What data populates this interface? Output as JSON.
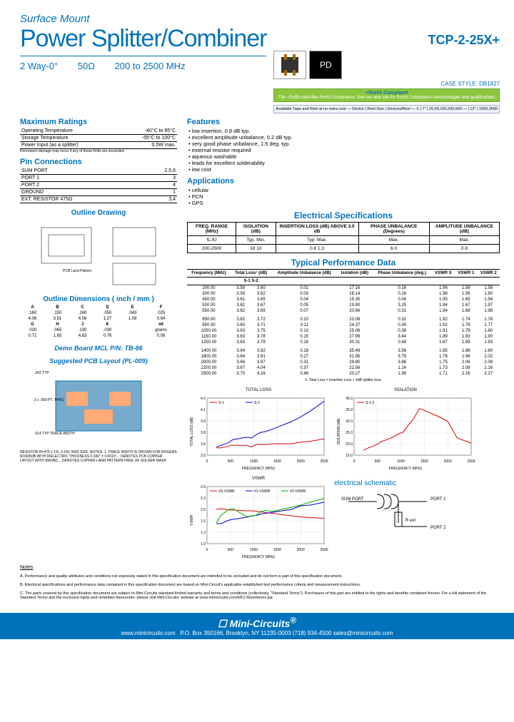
{
  "header": {
    "pretitle": "Surface Mount",
    "title": "Power Splitter/Combiner",
    "partno": "TCP-2-25X+",
    "subline": {
      "ways": "2 Way-0°",
      "impedance": "50Ω",
      "freq": "200 to 2500 MHz"
    },
    "case_style": "CASE STYLE: DB1827",
    "rohs_title": "+RoHS Compliant",
    "rohs_text": "The +Suffix identifies RoHS Compliance. See our web site for RoHS Compliance methodologies and qualifications"
  },
  "max_ratings": {
    "title": "Maximum Ratings",
    "rows": [
      [
        "Operating Temperature",
        "-40°C to 85°C"
      ],
      [
        "Storage Temperature",
        "-55°C to 100°C"
      ],
      [
        "Power Input (as a splitter)",
        "0.5W max."
      ]
    ],
    "note": "Permanent damage may occur if any of these limits are exceeded."
  },
  "pins": {
    "title": "Pin Connections",
    "rows": [
      [
        "SUM PORT",
        "2,5,6"
      ],
      [
        "PORT 1",
        "3"
      ],
      [
        "PORT 2",
        "4"
      ],
      [
        "GROUND",
        "1"
      ],
      [
        "EXT. RESISTOR 475Ω",
        "3,4"
      ]
    ]
  },
  "features": {
    "title": "Features",
    "items": [
      "low insertion, 0.8 dB typ.",
      "excellent amplitude unbalance, 0.2 dB typ.",
      "very good phase unbalance, 1.5 deg. typ.",
      "external resistor required",
      "aqueous washable",
      "leads for excellent solderability",
      "low cost"
    ]
  },
  "applications": {
    "title": "Applications",
    "items": [
      "cellular",
      "PCN",
      "GPS"
    ]
  },
  "espec": {
    "title": "Electrical Specifications",
    "headers": [
      "FREQ. RANGE (MHz)",
      "ISOLATION (dB)",
      "INSERTION LOSS (dB) ABOVE 3.0 dB",
      "PHASE UNBALANCE (Degrees)",
      "AMPLITUDE UNBALANCE (dB)"
    ],
    "sub": [
      "fL-fU",
      "Typ.  Min.",
      "Typ.  Max.",
      "Max.",
      "Max."
    ],
    "row": [
      "200-2500",
      "18   10",
      "0.8   1.3",
      "6.0",
      "0.8"
    ]
  },
  "perf": {
    "title": "Typical Performance Data",
    "headers": [
      "Frequency (MHz)",
      "Total Loss¹ (dB)",
      "Amplitude Unbalance (dB)",
      "Isolation (dB)",
      "Phase Unbalance (deg.)",
      "VSWR S",
      "VSWR 1",
      "VSWR 2"
    ],
    "sub": [
      "",
      "S-1   S-2",
      "",
      "",
      "",
      "",
      "",
      ""
    ],
    "rows": [
      [
        "200.00",
        "3.59",
        "3.60",
        "0.01",
        "17.16",
        "0.16",
        "1.96",
        "1.56",
        "1.58"
      ],
      [
        "300.00",
        "3.59",
        "3.62",
        "0.03",
        "18.14",
        "0.16",
        "1.98",
        "1.56",
        "1.80"
      ],
      [
        "450.00",
        "3.61",
        "3.65",
        "0.04",
        "19.35",
        "0.04",
        "1.95",
        "1.65",
        "1.94"
      ],
      [
        "500.00",
        "3.62",
        "3.67",
        "0.05",
        "19.80",
        "3.25",
        "1.94",
        "1.67",
        "1.97"
      ],
      [
        "550.00",
        "3.62",
        "3.69",
        "0.07",
        "20.66",
        "0.31",
        "1.94",
        "1.68",
        "1.98"
      ],
      [
        "850.00",
        "3.62",
        "3.72",
        "0.10",
        "23.08",
        "0.32",
        "1.92",
        "1.74",
        "1.76"
      ],
      [
        "950.00",
        "3.60",
        "3.71",
        "0.11",
        "24.37",
        "0.35",
        "1.92",
        "1.78",
        "1.77"
      ],
      [
        "1050.00",
        "3.63",
        "3.75",
        "0.13",
        "25.06",
        "0.38",
        "1.91",
        "1.79",
        "1.80"
      ],
      [
        "1150.00",
        "3.63",
        "3.78",
        "0.15",
        "27.99",
        "3.44",
        "1.89",
        "1.83",
        "1.90"
      ],
      [
        "1250.00",
        "3.63",
        "3.79",
        "0.16",
        "30.31",
        "0.48",
        "1.87",
        "1.85",
        "1.93"
      ],
      [
        "1400.00",
        "3.64",
        "3.82",
        "0.18",
        "35.48",
        "3.56",
        "1.85",
        "1.88",
        "1.90"
      ],
      [
        "1800.00",
        "3.64",
        "3.91",
        "0.27",
        "31.95",
        "3.79",
        "1.78",
        "1.96",
        "2.02"
      ],
      [
        "2000.00",
        "3.66",
        "3.97",
        "0.31",
        "29.80",
        "3.86",
        "1.75",
        "2.06",
        "2.08"
      ],
      [
        "2200.00",
        "3.67",
        "4.04",
        "0.37",
        "22.56",
        "1.14",
        "1.73",
        "2.08",
        "2.16"
      ],
      [
        "2500.00",
        "3.70",
        "4.16",
        "0.46",
        "20.27",
        "1.38",
        "1.71",
        "2.16",
        "2.27"
      ]
    ],
    "footnote": "1. Total Loss = Insertion Loss + 3dB splitter loss."
  },
  "chart_data": [
    {
      "type": "line",
      "title": "TOTAL LOSS",
      "xlabel": "FREQUENCY (MHz)",
      "ylabel": "TOTAL LOSS (dB)",
      "xlim": [
        0,
        2500
      ],
      "ylim": [
        3.5,
        4.2
      ],
      "x": [
        200,
        300,
        450,
        500,
        550,
        850,
        950,
        1050,
        1150,
        1250,
        1400,
        1800,
        2000,
        2200,
        2500
      ],
      "series": [
        {
          "name": "S-1",
          "color": "#d00",
          "values": [
            3.59,
            3.59,
            3.61,
            3.62,
            3.62,
            3.62,
            3.6,
            3.63,
            3.63,
            3.63,
            3.64,
            3.64,
            3.66,
            3.67,
            3.7
          ]
        },
        {
          "name": "S-2",
          "color": "#00d",
          "values": [
            3.6,
            3.62,
            3.65,
            3.67,
            3.69,
            3.72,
            3.71,
            3.75,
            3.78,
            3.79,
            3.82,
            3.91,
            3.97,
            4.04,
            4.16
          ]
        }
      ]
    },
    {
      "type": "line",
      "title": "ISOLATION",
      "xlabel": "FREQUENCY (MHz)",
      "ylabel": "ISOLATION (dB)",
      "xlim": [
        0,
        2500
      ],
      "ylim": [
        15,
        40
      ],
      "x": [
        200,
        300,
        450,
        500,
        550,
        850,
        950,
        1050,
        1150,
        1250,
        1400,
        1800,
        2000,
        2200,
        2500
      ],
      "series": [
        {
          "name": "S-1-2",
          "color": "#d00",
          "values": [
            17.16,
            18.14,
            19.35,
            19.8,
            20.66,
            23.08,
            24.37,
            25.06,
            27.99,
            30.31,
            35.48,
            31.95,
            29.8,
            22.56,
            20.27
          ]
        }
      ]
    },
    {
      "type": "line",
      "title": "VSWR",
      "xlabel": "FREQUENCY (MHz)",
      "ylabel": "VSWR",
      "xlim": [
        0,
        2500
      ],
      "ylim": [
        1.0,
        2.6
      ],
      "x": [
        200,
        300,
        450,
        500,
        550,
        850,
        950,
        1050,
        1150,
        1250,
        1400,
        1800,
        2000,
        2200,
        2500
      ],
      "series": [
        {
          "name": "#S-VSWR",
          "color": "#d00",
          "values": [
            1.96,
            1.98,
            1.95,
            1.94,
            1.94,
            1.92,
            1.92,
            1.91,
            1.89,
            1.87,
            1.85,
            1.78,
            1.75,
            1.73,
            1.71
          ]
        },
        {
          "name": "#1-VSWR",
          "color": "#00d",
          "values": [
            1.56,
            1.56,
            1.65,
            1.67,
            1.68,
            1.74,
            1.78,
            1.79,
            1.83,
            1.85,
            1.88,
            1.96,
            2.06,
            2.08,
            2.16
          ]
        },
        {
          "name": "#2-VSWR",
          "color": "#0a0",
          "values": [
            1.58,
            1.8,
            1.94,
            1.97,
            1.98,
            1.76,
            1.77,
            1.8,
            1.9,
            1.93,
            1.9,
            2.02,
            2.08,
            2.16,
            2.27
          ]
        }
      ]
    }
  ],
  "outline": {
    "drawing_title": "Outline Drawing",
    "dims_title": "Outline Dimensions ( inch / mm )",
    "headers": [
      "A",
      "B",
      "C",
      "D",
      "E",
      "F"
    ],
    "rows": [
      [
        ".160",
        ".150",
        ".160",
        ".050",
        ".043",
        ".025"
      ],
      [
        "4.06",
        "3.81",
        "4.06",
        "1.27",
        "1.09",
        "0.64"
      ]
    ],
    "headers2": [
      "G",
      "H",
      "J",
      "K",
      "",
      "wt"
    ],
    "rows2": [
      [
        ".020",
        ".065",
        ".190",
        ".030",
        "",
        "grams"
      ],
      [
        "0.71",
        "1.65",
        "4.83",
        "0.76",
        "",
        "0.08"
      ]
    ]
  },
  "demo": {
    "title1": "Demo Board MCL P/N: TB-86",
    "title2": "Suggested PCB Layout (PL-009)"
  },
  "schematic_title": "electrical schematic",
  "notes": {
    "title": "Notes",
    "items": [
      "A. Performance and quality attributes and conditions not expressly stated in this specification document are intended to be excluded and do not form a part of this specification document.",
      "B. Electrical specifications and performance data contained in this specification document are based on Mini-Circuit's applicable established test performance criteria and measurement instructions.",
      "C. The parts covered by this specification document are subject to Mini-Circuits standard limited warranty and terms and conditions (collectively, \"Standard Terms\"); Purchasers of this part are entitled to the rights and benefits contained therein. For a full statement of the Standard Terms and the exclusive rights and remedies thereunder, please visit Mini-Circuits' website at www.minicircuits.com/MCLStore/terms.jsp"
    ]
  },
  "footer": {
    "brand": "Mini-Circuits",
    "url": "www.minicircuits.com",
    "addr": "P.O. Box 350166, Brooklyn, NY 11235-0003  (718) 934-4500  sales@minicircuits.com"
  }
}
